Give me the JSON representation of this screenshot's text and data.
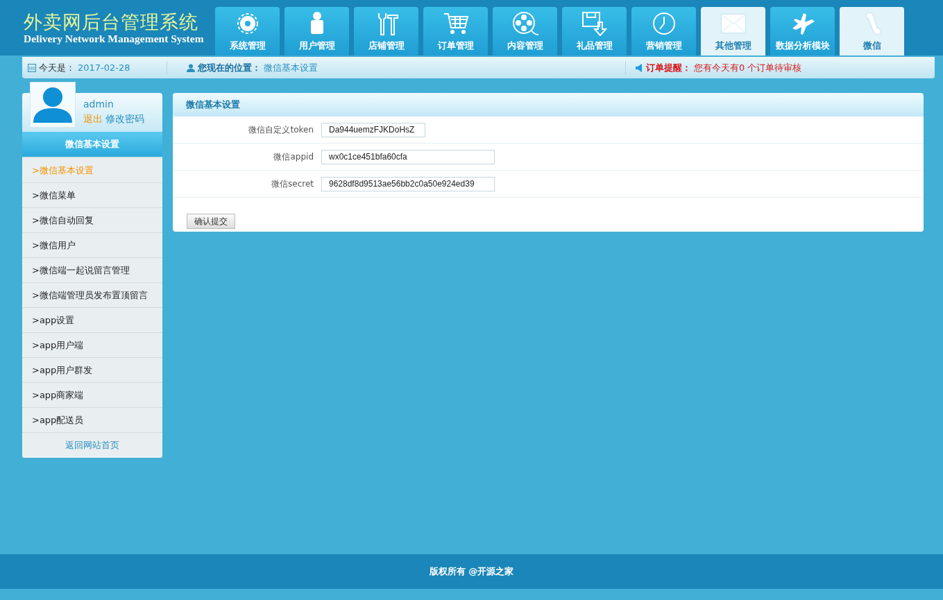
{
  "logo": {
    "title": "外卖网后台管理系统",
    "subtitle": "Delivery Network Management System"
  },
  "nav_tabs": [
    {
      "label": "系统管理",
      "selected": false
    },
    {
      "label": "用户管理",
      "selected": false
    },
    {
      "label": "店铺管理",
      "selected": false
    },
    {
      "label": "订单管理",
      "selected": false
    },
    {
      "label": "内容管理",
      "selected": false
    },
    {
      "label": "礼品管理",
      "selected": false
    },
    {
      "label": "营销管理",
      "selected": false
    },
    {
      "label": "其他管理",
      "selected": true
    },
    {
      "label": "数据分析模块",
      "selected": false
    },
    {
      "label": "微信",
      "selected": true
    }
  ],
  "info_bar": {
    "date_label": "今天是：",
    "date": "2017-02-28",
    "location_label": "您现在的位置：",
    "location": "微信基本设置",
    "alert_label": "订单提醒：",
    "alert": "您有今天有0 个订单待审核"
  },
  "sidebar": {
    "username": "admin",
    "logout": "退出",
    "change_password": "修改密码",
    "section_title": "微信基本设置",
    "items": [
      {
        "label": ">微信基本设置",
        "selected": true
      },
      {
        "label": ">微信菜单",
        "selected": false
      },
      {
        "label": ">微信自动回复",
        "selected": false
      },
      {
        "label": ">微信用户",
        "selected": false
      },
      {
        "label": ">微信端一起说留言管理",
        "selected": false
      },
      {
        "label": ">微信端管理员发布置顶留言",
        "selected": false
      },
      {
        "label": ">app设置",
        "selected": false
      },
      {
        "label": ">app用户端",
        "selected": false
      },
      {
        "label": ">app用户群发",
        "selected": false
      },
      {
        "label": ">app商家端",
        "selected": false
      },
      {
        "label": ">app配送员",
        "selected": false
      }
    ],
    "back_link": "返回网站首页"
  },
  "panel": {
    "title": "微信基本设置",
    "fields": [
      {
        "label": "微信自定义token",
        "value": "Da944uemzFJKDoHsZ"
      },
      {
        "label": "微信appid",
        "value": "wx0c1ce451bfa60cfa"
      },
      {
        "label": "微信secret",
        "value": "9628df8d9513ae56bb2c0a50e924ed39"
      }
    ],
    "submit": "确认提交"
  },
  "footer": "版权所有 @开源之家"
}
